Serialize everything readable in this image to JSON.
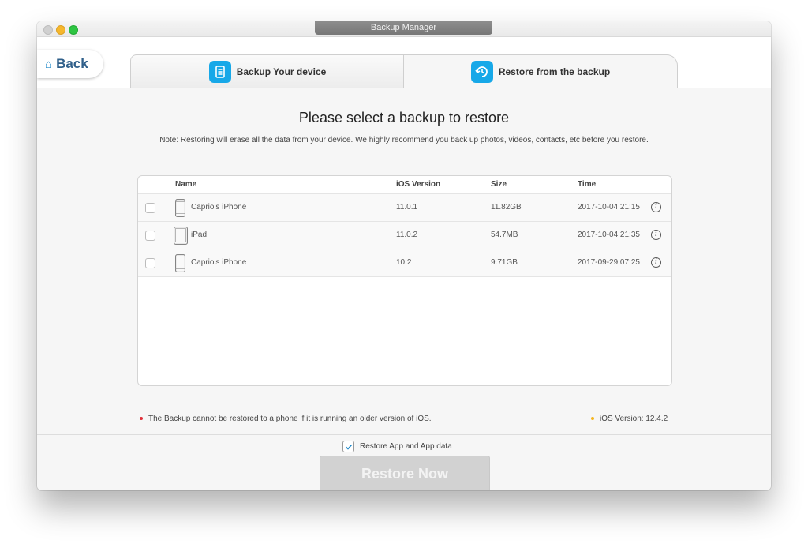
{
  "window": {
    "title": "Backup Manager"
  },
  "nav": {
    "back_label": "Back",
    "tabs": [
      {
        "label": "Backup Your device",
        "icon": "document-icon",
        "selected": false
      },
      {
        "label": "Restore from the backup",
        "icon": "restore-clock-icon",
        "selected": true
      }
    ]
  },
  "main": {
    "heading": "Please select a backup to restore",
    "note": "Note: Restoring will erase all the data from your device. We highly recommend you back up photos, videos, contacts, etc before you restore."
  },
  "table": {
    "columns": [
      "Name",
      "iOS Version",
      "Size",
      "Time"
    ],
    "rows": [
      {
        "device": "iphone-icon",
        "name": "Caprio's iPhone",
        "ios": "11.0.1",
        "size": "11.82GB",
        "time": "2017-10-04 21:15",
        "checked": false
      },
      {
        "device": "ipad-icon",
        "name": "iPad",
        "ios": "11.0.2",
        "size": "54.7MB",
        "time": "2017-10-04 21:35",
        "checked": false
      },
      {
        "device": "iphone-icon",
        "name": "Caprio's iPhone",
        "ios": "10.2",
        "size": "9.71GB",
        "time": "2017-09-29 07:25",
        "checked": false
      }
    ]
  },
  "footer": {
    "warning": "The Backup cannot be restored to a phone if it is running an older version of iOS.",
    "warning_color": "#e0303a",
    "ios_version": "iOS Version: 12.4.2",
    "ios_dot_color": "#f5b51e",
    "option_label": "Restore App and App data",
    "option_checked": true,
    "restore_button": "Restore Now"
  },
  "colors": {
    "accent": "#17a8e8",
    "back_text": "#2f5f8a"
  }
}
